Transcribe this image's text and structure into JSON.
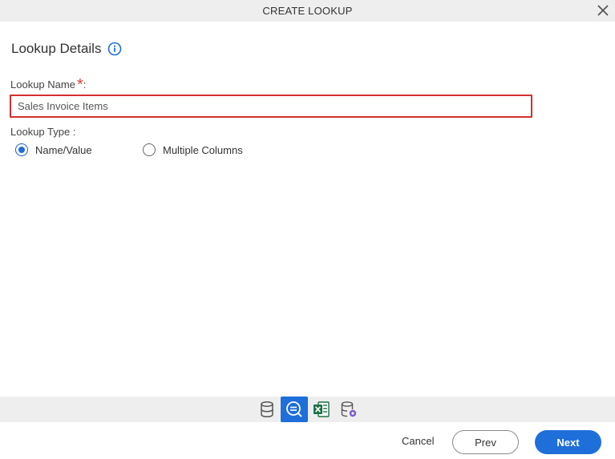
{
  "dialog": {
    "title": "CREATE LOOKUP"
  },
  "section": {
    "title": "Lookup Details",
    "info_icon": "info-icon"
  },
  "lookup_name": {
    "label": "Lookup Name",
    "required_mark": "*",
    "colon": ":",
    "value": "Sales Invoice Items"
  },
  "lookup_type": {
    "label": "Lookup Type :",
    "options": [
      {
        "label": "Name/Value",
        "selected": true
      },
      {
        "label": "Multiple Columns",
        "selected": false
      }
    ]
  },
  "toolbar": {
    "tools": [
      {
        "icon": "database-icon",
        "active": false
      },
      {
        "icon": "lookup-search-icon",
        "active": true
      },
      {
        "icon": "excel-icon",
        "active": false
      },
      {
        "icon": "database-settings-icon",
        "active": false
      }
    ]
  },
  "footer": {
    "cancel_label": "Cancel",
    "prev_label": "Prev",
    "next_label": "Next"
  },
  "colors": {
    "accent": "#1e6fd9",
    "error_border": "#d32f2f",
    "required": "#e53935",
    "excel_green": "#1d7044"
  }
}
